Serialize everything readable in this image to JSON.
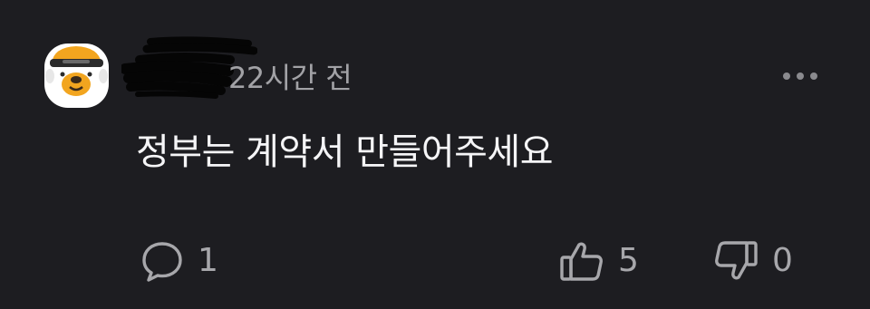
{
  "comment": {
    "timestamp": "22시간 전",
    "text": "정부는 계약서 만들어주세요",
    "reply_count": "1",
    "like_count": "5",
    "dislike_count": "0"
  },
  "icons": {
    "avatar": "cartoon-dog-face",
    "more": "more-horizontal-icon",
    "reply": "chat-bubble-icon",
    "like": "thumbs-up-icon",
    "dislike": "thumbs-down-icon"
  },
  "colors": {
    "background": "#1d1d21",
    "text": "#f5f5f7",
    "muted": "#a2a2a6",
    "avatar_accent": "#f2a51f"
  }
}
